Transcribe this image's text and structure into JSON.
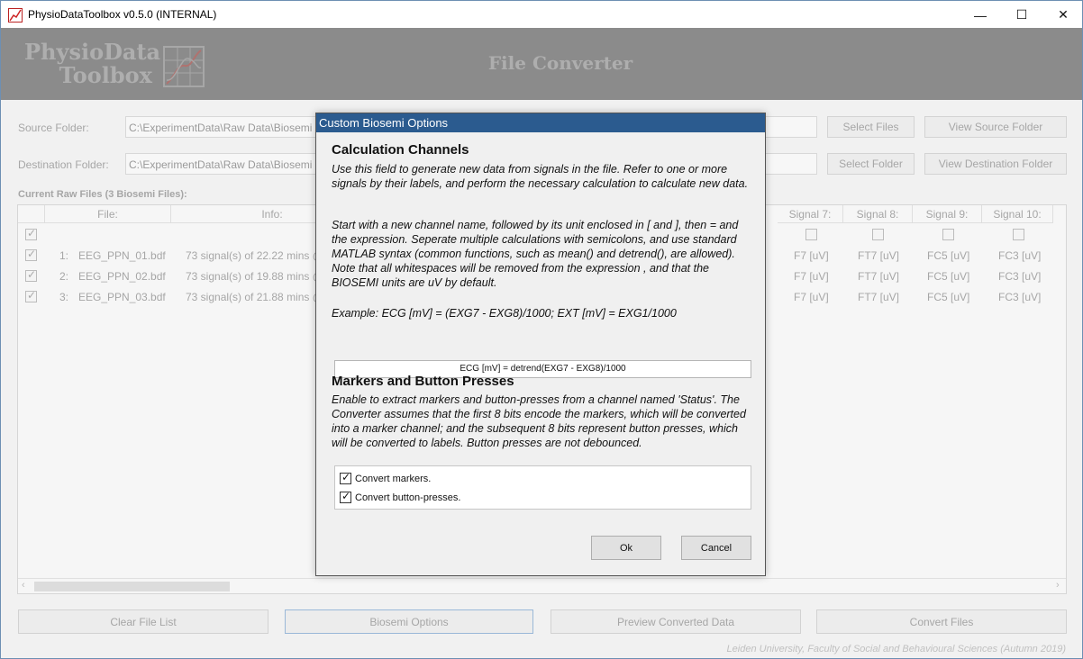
{
  "window": {
    "title": "PhysioDataToolbox v0.5.0 (INTERNAL)",
    "controls": {
      "minimize": "—",
      "maximize": "☐",
      "close": "✕"
    }
  },
  "banner": {
    "logo_line1": "PhysioData",
    "logo_line2": "Toolbox",
    "title": "File Converter"
  },
  "source": {
    "label": "Source Folder:",
    "value": "C:\\ExperimentData\\Raw Data\\Biosemi",
    "select_files": "Select Files",
    "view_folder": "View Source Folder"
  },
  "destination": {
    "label": "Destination Folder:",
    "value": "C:\\ExperimentData\\Raw Data\\Biosemi",
    "select_folder": "Select Folder",
    "view_folder": "View Destination Folder"
  },
  "files": {
    "label": "Current Raw Files (3 Biosemi Files):",
    "headers": {
      "file": "File:",
      "info": "Info:",
      "s7": "Signal 7:",
      "s8": "Signal 8:",
      "s9": "Signal 9:",
      "s10": "Signal 10:"
    },
    "rows": [
      {
        "num": "1:",
        "name": "EEG_PPN_01.bdf",
        "info": "73 signal(s) of 22.22 mins @",
        "s7": "F7 [uV]",
        "s8": "FT7 [uV]",
        "s9": "FC5 [uV]",
        "s10": "FC3 [uV]"
      },
      {
        "num": "2:",
        "name": "EEG_PPN_02.bdf",
        "info": "73 signal(s) of 19.88 mins @",
        "s7": "F7 [uV]",
        "s8": "FT7 [uV]",
        "s9": "FC5 [uV]",
        "s10": "FC3 [uV]"
      },
      {
        "num": "3:",
        "name": "EEG_PPN_03.bdf",
        "info": "73 signal(s) of 21.88 mins @",
        "s7": "F7 [uV]",
        "s8": "FT7 [uV]",
        "s9": "FC5 [uV]",
        "s10": "FC3 [uV]"
      }
    ]
  },
  "buttons": {
    "clear": "Clear File List",
    "options": "Biosemi Options",
    "preview": "Preview Converted Data",
    "convert": "Convert Files"
  },
  "footer": "Leiden University, Faculty of Social and Behavioural Sciences (Autumn 2019)",
  "dialog": {
    "title": "Custom Biosemi Options",
    "calc_heading": "Calculation Channels",
    "calc_para1": "Use this field to generate new data from signals in the file. Refer to one or more signals by their labels, and perform the necessary calculation to calculate new data.",
    "calc_para2": "Start with a new channel name, followed by its unit enclosed in [ and ], then = and the expression. Seperate multiple calculations with semicolons, and use standard MATLAB syntax (common functions, such as mean() and detrend(), are allowed). Note that all whitespaces will be removed from the expression , and that the BIOSEMI units are uV by default.",
    "calc_example": "Example: ECG [mV] = (EXG7 - EXG8)/1000; EXT [mV] = EXG1/1000",
    "expression": "ECG [mV] = detrend(EXG7 - EXG8)/1000",
    "markers_heading": "Markers and Button Presses",
    "markers_para": "Enable to extract markers and button-presses from a channel named 'Status'. The Converter assumes that the first 8 bits encode the markers, which will be converted into a marker channel; and the subsequent 8 bits represent button presses, which will be converted to labels. Button presses are not debounced.",
    "opt_markers": "Convert markers.",
    "opt_buttons": "Convert button-presses.",
    "ok": "Ok",
    "cancel": "Cancel"
  }
}
